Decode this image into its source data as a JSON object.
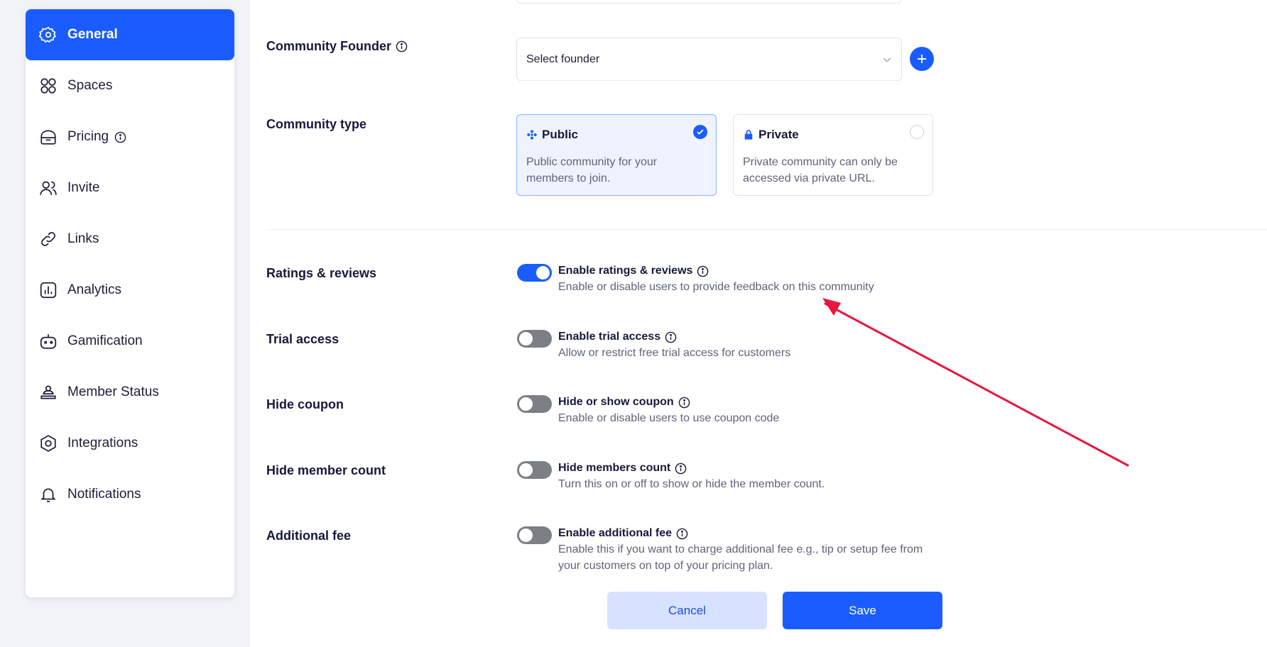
{
  "sidebar": {
    "items": [
      {
        "label": "General",
        "icon": "gear-icon",
        "active": true
      },
      {
        "label": "Spaces",
        "icon": "spaces-icon"
      },
      {
        "label": "Pricing",
        "icon": "pricing-icon",
        "info": true
      },
      {
        "label": "Invite",
        "icon": "users-icon"
      },
      {
        "label": "Links",
        "icon": "link-icon"
      },
      {
        "label": "Analytics",
        "icon": "analytics-icon"
      },
      {
        "label": "Gamification",
        "icon": "gamepad-icon"
      },
      {
        "label": "Member Status",
        "icon": "member-status-icon"
      },
      {
        "label": "Integrations",
        "icon": "integrations-icon"
      },
      {
        "label": "Notifications",
        "icon": "bell-icon"
      }
    ]
  },
  "founder": {
    "label": "Community Founder",
    "placeholder": "Select founder"
  },
  "community_type": {
    "label": "Community type",
    "public": {
      "title": "Public",
      "desc": "Public community for your members to join.",
      "selected": true
    },
    "private": {
      "title": "Private",
      "desc": "Private community can only be accessed via private URL.",
      "selected": false
    }
  },
  "options": [
    {
      "label": "Ratings & reviews",
      "title": "Enable ratings & reviews",
      "desc": "Enable or disable users to provide feedback on this community",
      "enabled": true
    },
    {
      "label": "Trial access",
      "title": "Enable trial access",
      "desc": "Allow or restrict free trial access for customers",
      "enabled": false
    },
    {
      "label": "Hide coupon",
      "title": "Hide or show coupon",
      "desc": "Enable or disable users to use coupon code",
      "enabled": false
    },
    {
      "label": "Hide member count",
      "title": "Hide members count",
      "desc": "Turn this on or off to show or hide the member count.",
      "enabled": false
    },
    {
      "label": "Additional fee",
      "title": "Enable additional fee",
      "desc": "Enable this if you want to charge additional fee e.g., tip or setup fee from your customers on top of your pricing plan.",
      "enabled": false
    }
  ],
  "actions": {
    "cancel": "Cancel",
    "save": "Save"
  },
  "colors": {
    "accent": "#1a5cff",
    "annotation_arrow": "#e8153f"
  }
}
